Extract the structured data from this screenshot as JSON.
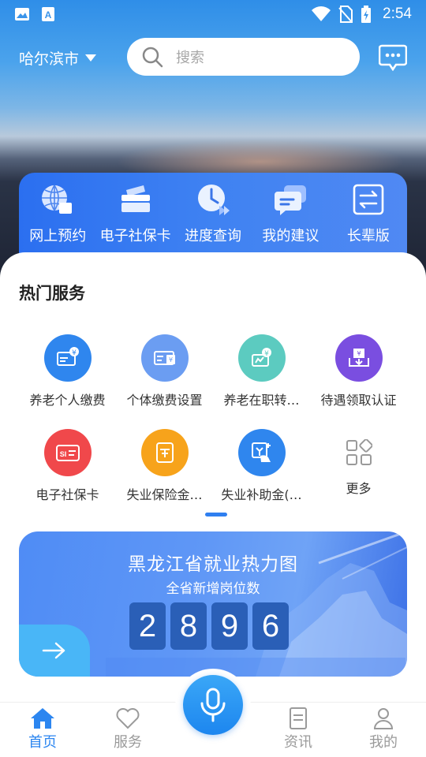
{
  "status_bar": {
    "time": "2:54"
  },
  "header": {
    "city": "哈尔滨市",
    "search_placeholder": "搜索"
  },
  "quick_menu": [
    {
      "label": "网上预约",
      "icon": "globe-icon"
    },
    {
      "label": "电子社保卡",
      "icon": "card-stack-icon"
    },
    {
      "label": "进度查询",
      "icon": "clock-icon"
    },
    {
      "label": "我的建议",
      "icon": "chat-bubbles-icon"
    },
    {
      "label": "长辈版",
      "icon": "switch-arrows-icon"
    }
  ],
  "hot_services": {
    "title": "热门服务",
    "items": [
      {
        "label": "养老个人缴费",
        "color": "#2f86ee"
      },
      {
        "label": "个体缴费设置",
        "color": "#6b9df2"
      },
      {
        "label": "养老在职转…",
        "color": "#5ccbc0"
      },
      {
        "label": "待遇领取认证",
        "color": "#7a4ee0"
      },
      {
        "label": "电子社保卡",
        "color": "#f0484b"
      },
      {
        "label": "失业保险金…",
        "color": "#f7a31b"
      },
      {
        "label": "失业补助金(…",
        "color": "#2f86ee"
      },
      {
        "label": "更多",
        "color": "#9a9a9a"
      }
    ]
  },
  "banner": {
    "title": "黑龙江省就业热力图",
    "subtitle": "全省新增岗位数",
    "digits": [
      "2",
      "8",
      "9",
      "6"
    ]
  },
  "bottom_nav": {
    "home": "首页",
    "services": "服务",
    "news": "资讯",
    "mine": "我的"
  }
}
